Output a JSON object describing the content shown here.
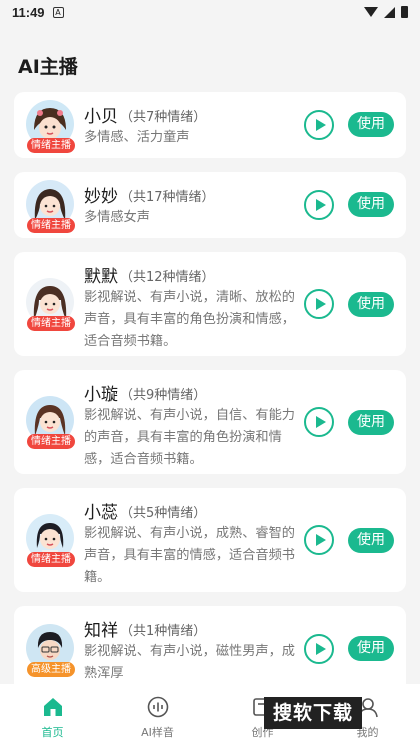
{
  "status_bar": {
    "time": "11:49",
    "notif_letter": "A"
  },
  "page": {
    "title": "AI主播"
  },
  "anchors": [
    {
      "name": "小贝",
      "count": "（共7种情绪）",
      "desc": "多情感、活力童声",
      "tag": "情绪主播",
      "tag_color": "#f0473e"
    },
    {
      "name": "妙妙",
      "count": "（共17种情绪）",
      "desc": "多情感女声",
      "tag": "情绪主播",
      "tag_color": "#f0473e"
    },
    {
      "name": "默默",
      "count": "（共12种情绪）",
      "desc": "影视解说、有声小说，清晰、放松的声音，具有丰富的角色扮演和情感，适合音频书籍。",
      "tag": "情绪主播",
      "tag_color": "#f0473e"
    },
    {
      "name": "小璇",
      "count": "（共9种情绪）",
      "desc": "影视解说、有声小说，自信、有能力的声音，具有丰富的角色扮演和情感，适合音频书籍。",
      "tag": "情绪主播",
      "tag_color": "#f0473e"
    },
    {
      "name": "小蕊",
      "count": "（共5种情绪）",
      "desc": "影视解说、有声小说，成熟、睿智的声音，具有丰富的情感，适合音频书籍。",
      "tag": "情绪主播",
      "tag_color": "#f0473e"
    },
    {
      "name": "知祥",
      "count": "（共1种情绪）",
      "desc": "影视解说、有声小说，磁性男声，成熟浑厚",
      "tag": "高级主播",
      "tag_color": "#f5932b"
    }
  ],
  "use_label": "使用",
  "nav": [
    {
      "label": "首页",
      "icon": "home-icon",
      "active": true
    },
    {
      "label": "AI样音",
      "icon": "audio-wave-icon",
      "active": false
    },
    {
      "label": "创作",
      "icon": "create-icon",
      "active": false
    },
    {
      "label": "我的",
      "icon": "profile-icon",
      "active": false
    }
  ],
  "watermark": "搜软下载",
  "colors": {
    "accent": "#1bb98f",
    "tag_red": "#f0473e",
    "tag_orange": "#f5932b",
    "background": "#f4f4f4"
  }
}
